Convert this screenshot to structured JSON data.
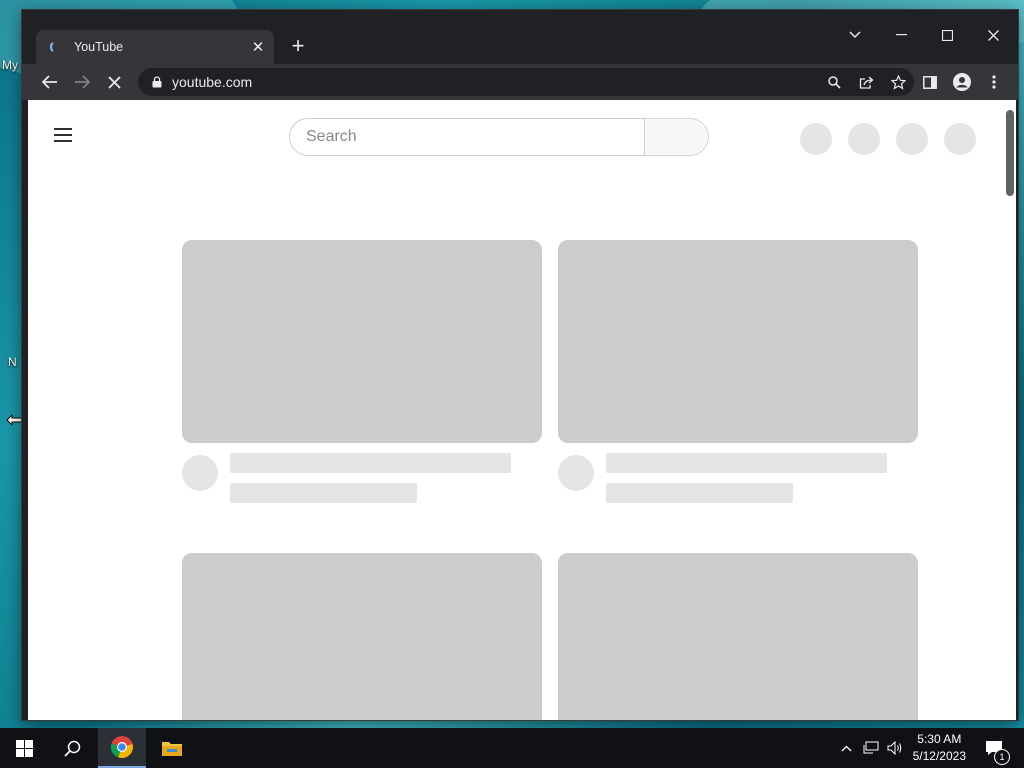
{
  "desktop": {
    "left_labels": [
      "My",
      "N"
    ]
  },
  "browser": {
    "tab_title": "YouTube",
    "tab_close_glyph": "✕",
    "new_tab_glyph": "+",
    "window_controls": [
      "chevron-down-icon",
      "minimize-icon",
      "maximize-icon",
      "close-icon"
    ],
    "url": "youtube.com",
    "omnibox_icons": [
      "zoom-icon",
      "share-icon",
      "bookmark-star-icon"
    ],
    "toolbar_icons": [
      "side-panel-icon",
      "profile-icon",
      "more-menu-icon"
    ]
  },
  "youtube": {
    "search_placeholder": "Search",
    "header_placeholders": 4,
    "grid_placeholders": 4
  },
  "taskbar": {
    "time": "5:30 AM",
    "date": "5/12/2023",
    "notification_count": "1",
    "apps": [
      "chrome-icon",
      "file-explorer-icon"
    ]
  },
  "colors": {
    "chrome_dark": "#202124",
    "chrome_toolbar": "#35363a",
    "placeholder_thumb": "#cccccc",
    "placeholder_line": "#e5e5e5"
  }
}
